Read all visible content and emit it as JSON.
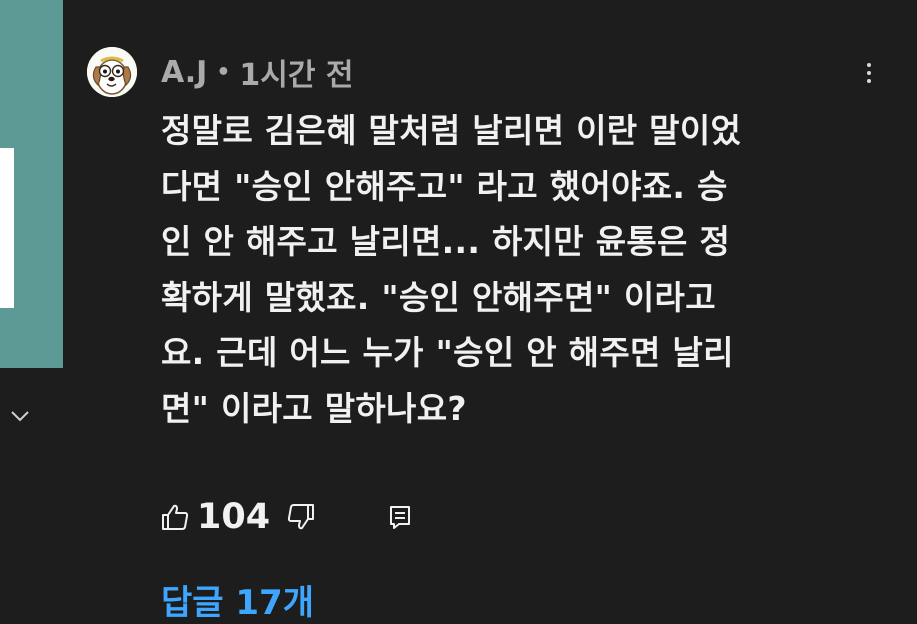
{
  "comment": {
    "author": "A.J",
    "separator": "•",
    "time": "1시간 전",
    "avatar_icon": "cartoon-dog-avatar",
    "lines": [
      "정말로 김은혜 말처럼 날리면 이란 말이었",
      "다면 \"승인 안해주고\" 라고 했어야죠. 승",
      "인 안 해주고 날리면... 하지만 윤통은 정",
      "확하게 말했죠. \"승인 안해주면\" 이라고",
      "요. 근데 어느 누가 \"승인 안 해주면 날리",
      "면\" 이라고 말하나요?"
    ],
    "like_count": "104",
    "replies_label": "답글 17개"
  },
  "icons": {
    "menu": "more-vert-icon",
    "like": "thumb-up-icon",
    "dislike": "thumb-down-icon",
    "reply": "reply-icon",
    "expand": "chevron-down-icon"
  },
  "colors": {
    "background": "#1d1d1d",
    "text": "#f1f1f1",
    "meta_text": "#aaaaaa",
    "link": "#3ea6ff",
    "side_panel": "#5e9a95"
  }
}
